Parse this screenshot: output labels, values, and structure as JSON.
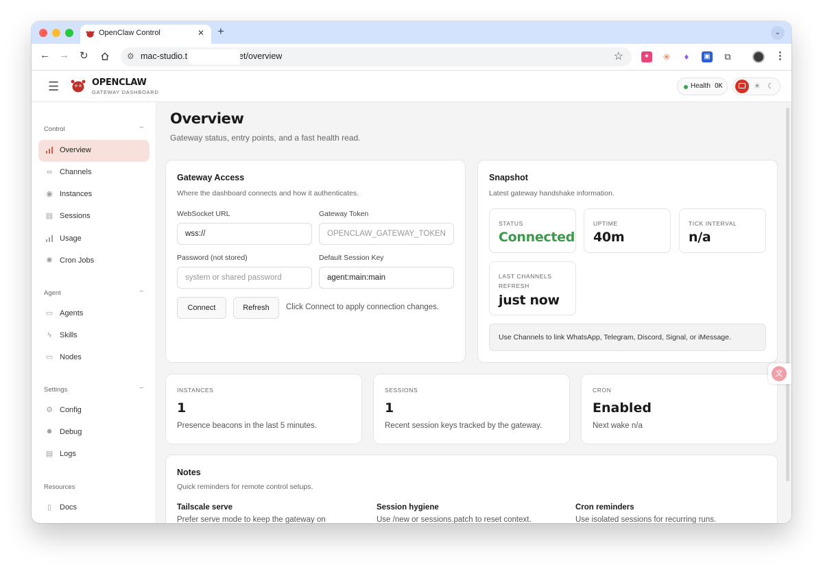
{
  "browser": {
    "tab_title": "OpenClaw Control",
    "tab_close": "✕",
    "new_tab": "+",
    "url_visible_start": "mac-studio.t",
    "url_visible_end": "et/overview",
    "extension_icons": [
      "puzzle-pink",
      "burst-orange",
      "flask-purple",
      "bookmark-blue",
      "puzzle"
    ]
  },
  "header": {
    "brand": "OPENCLAW",
    "brand_sub": "GATEWAY DASHBOARD",
    "health_label": "Health",
    "health_value": "OK"
  },
  "sidebar": {
    "sections": [
      {
        "label": "Control",
        "toggle": "−"
      },
      {
        "label": "Agent",
        "toggle": "−"
      },
      {
        "label": "Settings",
        "toggle": "−"
      },
      {
        "label": "Resources"
      }
    ],
    "items": [
      {
        "label": "Overview",
        "icon": "bar-chart-icon",
        "active": true
      },
      {
        "label": "Channels",
        "icon": "link-icon"
      },
      {
        "label": "Instances",
        "icon": "radio-icon"
      },
      {
        "label": "Sessions",
        "icon": "file-icon"
      },
      {
        "label": "Usage",
        "icon": "bar-chart-icon"
      },
      {
        "label": "Cron Jobs",
        "icon": "loader-icon"
      },
      {
        "label": "Agents",
        "icon": "folder-icon"
      },
      {
        "label": "Skills",
        "icon": "bolt-icon"
      },
      {
        "label": "Nodes",
        "icon": "monitor-icon"
      },
      {
        "label": "Config",
        "icon": "gear-icon"
      },
      {
        "label": "Debug",
        "icon": "bug-icon"
      },
      {
        "label": "Logs",
        "icon": "scroll-icon"
      },
      {
        "label": "Docs",
        "icon": "book-icon"
      }
    ]
  },
  "page": {
    "title": "Overview",
    "subtitle": "Gateway status, entry points, and a fast health read."
  },
  "gateway_access": {
    "title": "Gateway Access",
    "subtitle": "Where the dashboard connects and how it authenticates.",
    "websocket_label": "WebSocket URL",
    "websocket_value": "wss://",
    "token_label": "Gateway Token",
    "token_placeholder": "OPENCLAW_GATEWAY_TOKEN",
    "password_label": "Password (not stored)",
    "password_placeholder": "system or shared password",
    "session_key_label": "Default Session Key",
    "session_key_value": "agent:main:main",
    "connect_label": "Connect",
    "refresh_label": "Refresh",
    "hint": "Click Connect to apply connection changes."
  },
  "snapshot": {
    "title": "Snapshot",
    "subtitle": "Latest gateway handshake information.",
    "stats": [
      {
        "label": "STATUS",
        "value": "Connected"
      },
      {
        "label": "UPTIME",
        "value": "40m"
      },
      {
        "label": "TICK INTERVAL",
        "value": "n/a"
      },
      {
        "label": "LAST CHANNELS REFRESH",
        "value": "just now"
      }
    ],
    "tip": "Use Channels to link WhatsApp, Telegram, Discord, Signal, or iMessage."
  },
  "summary": [
    {
      "label": "INSTANCES",
      "value": "1",
      "desc": "Presence beacons in the last 5 minutes."
    },
    {
      "label": "SESSIONS",
      "value": "1",
      "desc": "Recent session keys tracked by the gateway."
    },
    {
      "label": "CRON",
      "value": "Enabled",
      "desc": "Next wake n/a"
    }
  ],
  "notes": {
    "title": "Notes",
    "subtitle": "Quick reminders for remote control setups.",
    "items": [
      {
        "head": "Tailscale serve",
        "text": "Prefer serve mode to keep the gateway on"
      },
      {
        "head": "Session hygiene",
        "text": "Use /new or sessions.patch to reset context."
      },
      {
        "head": "Cron reminders",
        "text": "Use isolated sessions for recurring runs."
      }
    ]
  },
  "colors": {
    "accent": "#d93025",
    "active_nav_bg": "#f8e1dc",
    "connected": "#3a9a4a",
    "health_dot": "#34a853"
  }
}
